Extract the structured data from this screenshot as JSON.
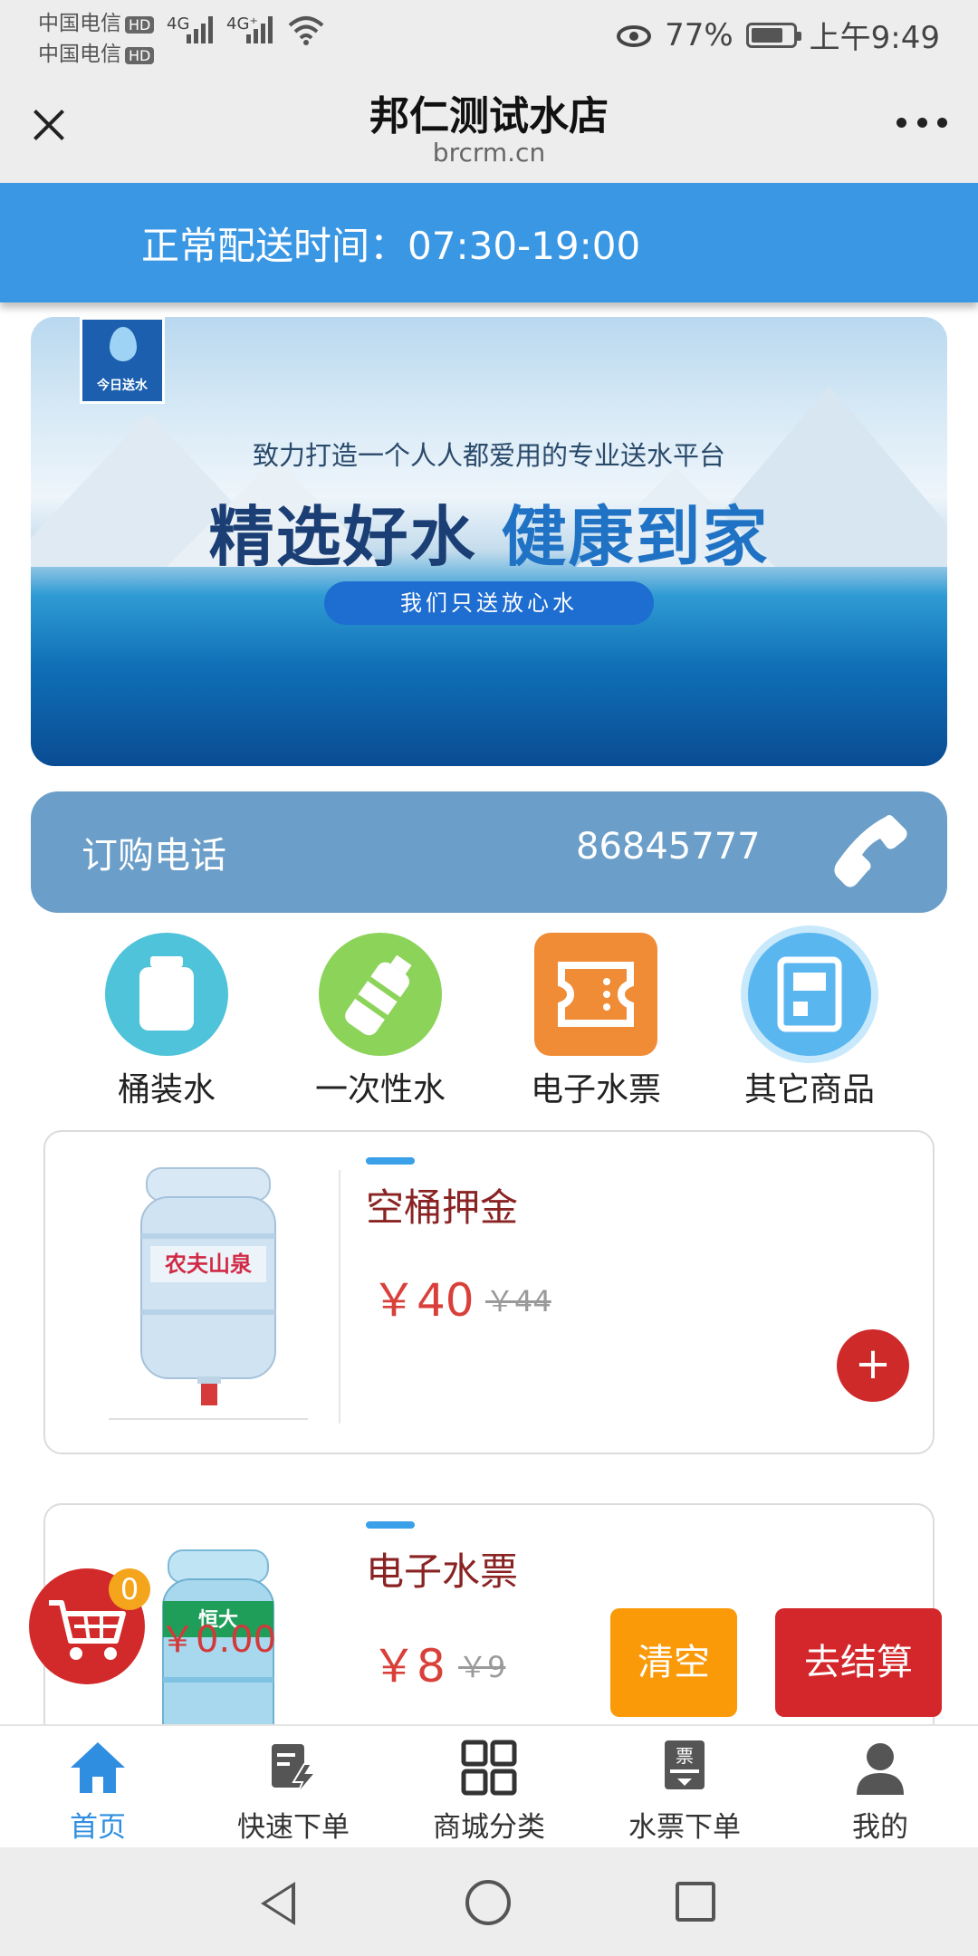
{
  "status_bar": {
    "carrier1": "中国电信",
    "carrier2": "中国电信",
    "hd_badge": "HD",
    "network1": "4G",
    "network2": "4G⁺",
    "battery_percent": "77%",
    "battery_level": 0.77,
    "time": "上午9:49"
  },
  "header": {
    "title": "邦仁测试水店",
    "url": "brcrm.cn"
  },
  "delivery_banner": {
    "text": "正常配送时间：07:30-19:00"
  },
  "hero": {
    "logo_text": "今日送水",
    "tagline": "致力打造一个人人都爱用的专业送水平台",
    "headline_part1": "精选好水",
    "headline_part2": "健康到家",
    "pill": "我们只送放心水"
  },
  "phone_bar": {
    "label": "订购电话",
    "number": "86845777"
  },
  "categories": [
    {
      "label": "桶装水",
      "icon": "barrel-water-icon",
      "color": "#4ec3d9"
    },
    {
      "label": "一次性水",
      "icon": "bottle-icon",
      "color": "#8cd35a"
    },
    {
      "label": "电子水票",
      "icon": "ticket-icon",
      "color": "#f08b36"
    },
    {
      "label": "其它商品",
      "icon": "dispenser-icon",
      "color": "#5ab6ef"
    }
  ],
  "products": [
    {
      "title": "空桶押金",
      "price": "￥40",
      "old_price": "￥44",
      "brand_text": "农夫山泉"
    },
    {
      "title": "电子水票",
      "price": "￥8",
      "old_price": "￥9",
      "brand_text": "恒大"
    }
  ],
  "cart": {
    "count": "0",
    "total": "￥0.00",
    "clear_label": "清空",
    "checkout_label": "去结算"
  },
  "bottom_nav": [
    {
      "label": "首页",
      "icon": "home-icon",
      "active": true
    },
    {
      "label": "快速下单",
      "icon": "quick-order-icon",
      "active": false
    },
    {
      "label": "商城分类",
      "icon": "grid-category-icon",
      "active": false
    },
    {
      "label": "水票下单",
      "icon": "ticket-order-icon",
      "active": false
    },
    {
      "label": "我的",
      "icon": "user-icon",
      "active": false
    }
  ],
  "colors": {
    "accent_blue": "#3a97e4",
    "phone_bar": "#6b9ec8",
    "price_red": "#d9403a",
    "title_red": "#8a2323",
    "clear_orange": "#fb9a08",
    "checkout_red": "#d3272b",
    "nav_active": "#2f8ee0"
  }
}
